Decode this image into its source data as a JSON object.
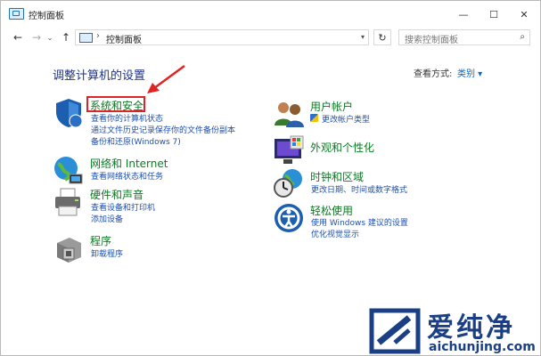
{
  "window": {
    "title": "控制面板",
    "controls": {
      "minimize": "—",
      "maximize": "☐",
      "close": "✕"
    }
  },
  "nav": {
    "back": "←",
    "forward": "→",
    "history": "⌄",
    "up": "↑",
    "address_separator": "›",
    "address": "控制面板",
    "refresh": "↻",
    "search_placeholder": "搜索控制面板"
  },
  "main": {
    "heading": "调整计算机的设置",
    "view_by_label": "查看方式:",
    "view_by_value": "类别 ▾"
  },
  "categories_left": [
    {
      "title": "系统和安全",
      "links": [
        "查看你的计算机状态",
        "通过文件历史记录保存你的文件备份副本",
        "备份和还原(Windows 7)"
      ]
    },
    {
      "title": "网络和 Internet",
      "links": [
        "查看网络状态和任务"
      ]
    },
    {
      "title": "硬件和声音",
      "links": [
        "查看设备和打印机",
        "添加设备"
      ]
    },
    {
      "title": "程序",
      "links": [
        "卸载程序"
      ]
    }
  ],
  "categories_right": [
    {
      "title": "用户帐户",
      "links": [
        "更改帐户类型"
      ]
    },
    {
      "title": "外观和个性化",
      "links": []
    },
    {
      "title": "时钟和区域",
      "links": [
        "更改日期、时间或数字格式"
      ]
    },
    {
      "title": "轻松使用",
      "links": [
        "使用 Windows 建议的设置",
        "优化视觉显示"
      ]
    }
  ],
  "watermark": {
    "title": "爱纯净",
    "url": "aichunjing.com"
  },
  "colors": {
    "category_title": "#0c7a23",
    "link": "#1e50b0",
    "heading": "#1e3287",
    "highlight": "#e02424"
  },
  "icons": {
    "system_security": "shield-icon",
    "network": "globe-network-icon",
    "hardware_sound": "printer-icon",
    "programs": "programs-box-icon",
    "user_accounts": "users-icon",
    "appearance": "monitor-palette-icon",
    "clock_region": "clock-globe-icon",
    "ease_of_access": "accessibility-icon"
  }
}
